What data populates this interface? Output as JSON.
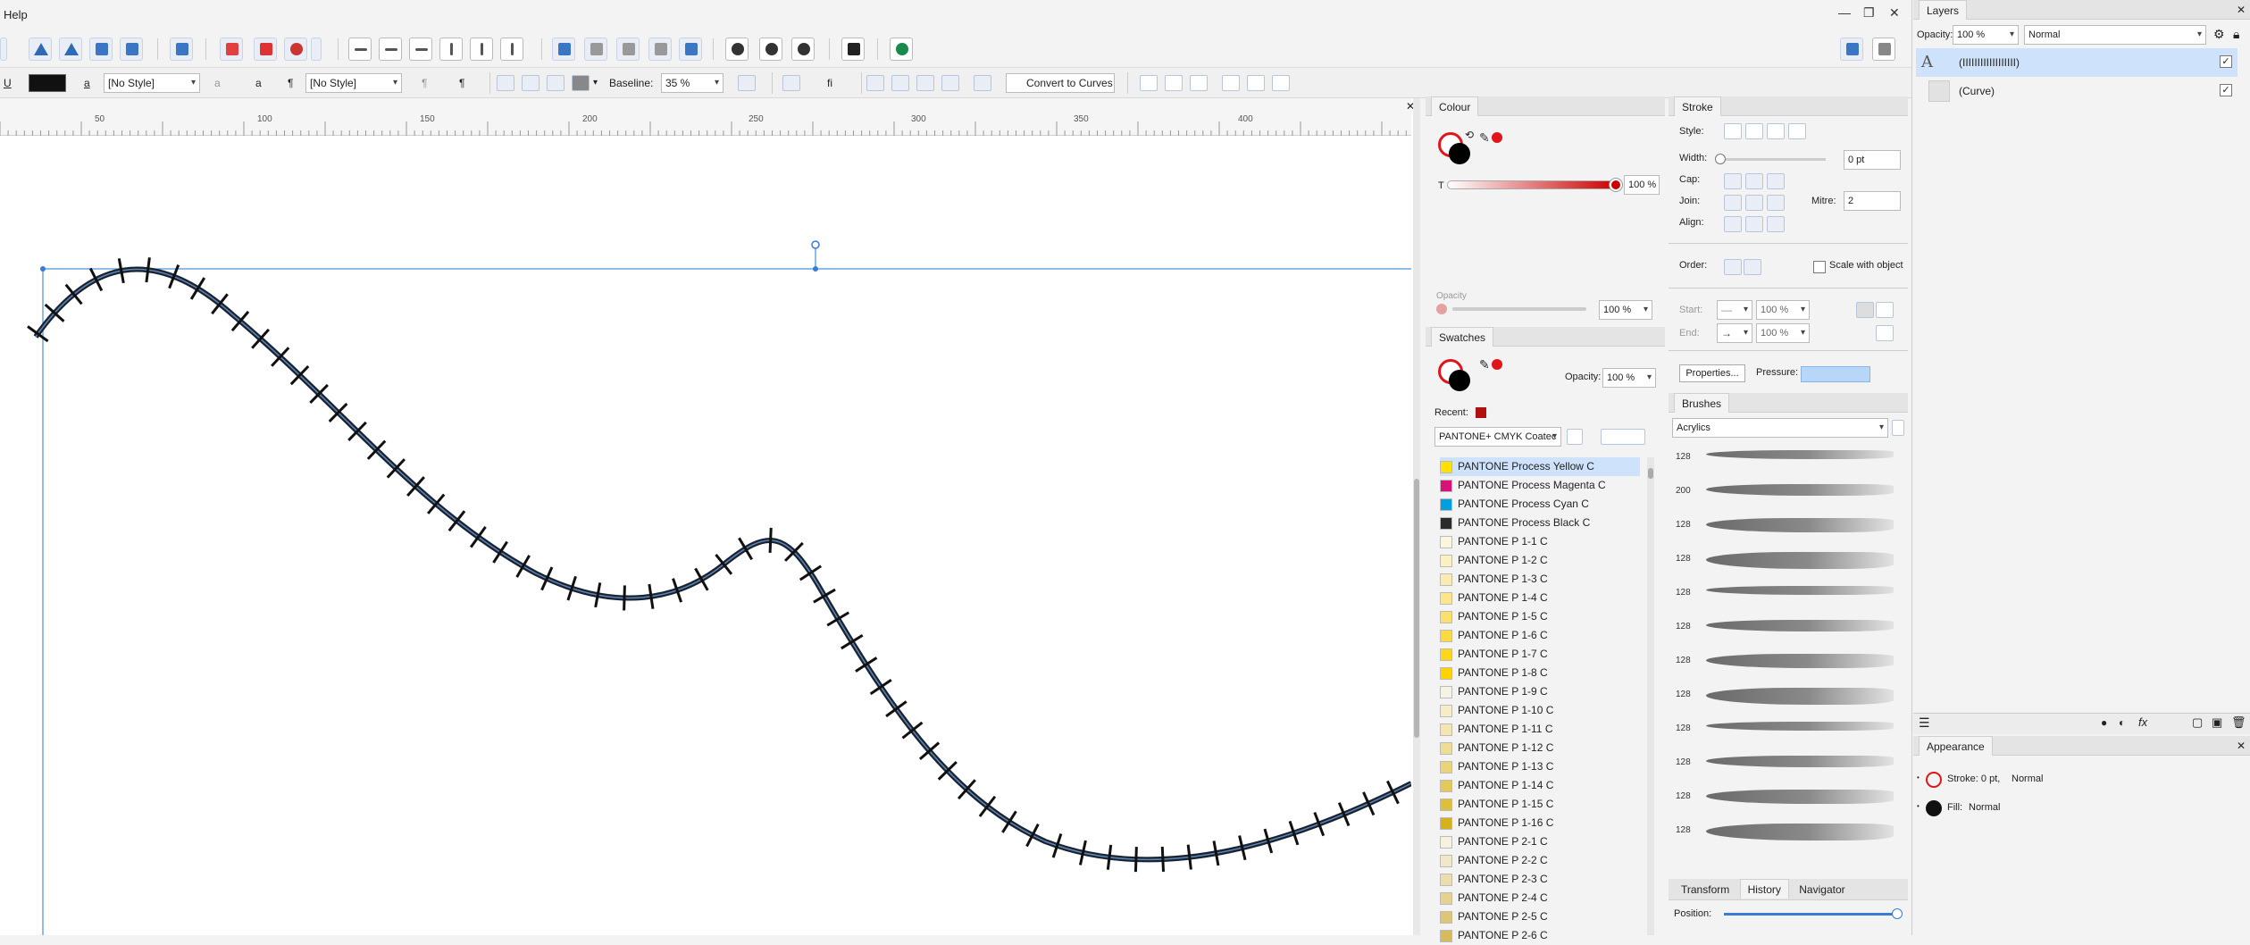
{
  "menu": {
    "help": "Help"
  },
  "window": {
    "minimize": "—",
    "restore": "❐",
    "close": "✕"
  },
  "context_toolbar": {
    "underline": "U",
    "char_style": "[No Style]",
    "para_style": "[No Style]",
    "char_icon_a": "a",
    "char_icon_a2": "a",
    "pilcrow": "¶",
    "pilcrow2": "¶",
    "baseline_label": "Baseline:",
    "baseline_value": "35 %",
    "fi": "fi",
    "convert_to_curves": "Convert to Curves"
  },
  "ruler": {
    "ticks": [
      "50",
      "100",
      "150",
      "200",
      "250",
      "300",
      "350",
      "400"
    ]
  },
  "colour_panel": {
    "title": "Colour",
    "t_label": "T",
    "t_value": "100 %",
    "opacity_label": "Opacity",
    "opacity_value": "100 %"
  },
  "swatches_panel": {
    "title": "Swatches",
    "opacity_label": "Opacity:",
    "opacity_value": "100 %",
    "recent_label": "Recent:",
    "palette": "PANTONE+ CMYK Coatec",
    "items": [
      {
        "name": "PANTONE Process Yellow C",
        "color": "#FFE000"
      },
      {
        "name": "PANTONE Process Magenta C",
        "color": "#D6127A"
      },
      {
        "name": "PANTONE Process Cyan C",
        "color": "#009FDF"
      },
      {
        "name": "PANTONE Process Black C",
        "color": "#2B2B2B"
      },
      {
        "name": "PANTONE P 1-1 C",
        "color": "#FAF6E0"
      },
      {
        "name": "PANTONE P 1-2 C",
        "color": "#FBF0C0"
      },
      {
        "name": "PANTONE P 1-3 C",
        "color": "#FBEBB0"
      },
      {
        "name": "PANTONE P 1-4 C",
        "color": "#FCE58A"
      },
      {
        "name": "PANTONE P 1-5 C",
        "color": "#FCE06A"
      },
      {
        "name": "PANTONE P 1-6 C",
        "color": "#FDDB40"
      },
      {
        "name": "PANTONE P 1-7 C",
        "color": "#FFD61A"
      },
      {
        "name": "PANTONE P 1-8 C",
        "color": "#FFD200"
      },
      {
        "name": "PANTONE P 1-9 C",
        "color": "#F7F3E4"
      },
      {
        "name": "PANTONE P 1-10 C",
        "color": "#F6EDC6"
      },
      {
        "name": "PANTONE P 1-11 C",
        "color": "#F3E6AE"
      },
      {
        "name": "PANTONE P 1-12 C",
        "color": "#EEDD92"
      },
      {
        "name": "PANTONE P 1-13 C",
        "color": "#E9D47A"
      },
      {
        "name": "PANTONE P 1-14 C",
        "color": "#E2C95A"
      },
      {
        "name": "PANTONE P 1-15 C",
        "color": "#DDBF3C"
      },
      {
        "name": "PANTONE P 1-16 C",
        "color": "#D5B21C"
      },
      {
        "name": "PANTONE P 2-1 C",
        "color": "#F6F1DE"
      },
      {
        "name": "PANTONE P 2-2 C",
        "color": "#F1E8C6"
      },
      {
        "name": "PANTONE P 2-3 C",
        "color": "#ECDDAA"
      },
      {
        "name": "PANTONE P 2-4 C",
        "color": "#E5D190"
      },
      {
        "name": "PANTONE P 2-5 C",
        "color": "#DFC677"
      },
      {
        "name": "PANTONE P 2-6 C",
        "color": "#D7BA5E"
      }
    ]
  },
  "stroke_panel": {
    "title": "Stroke",
    "style_label": "Style:",
    "width_label": "Width:",
    "width_value": "0 pt",
    "cap_label": "Cap:",
    "join_label": "Join:",
    "mitre_label": "Mitre:",
    "mitre_value": "2",
    "align_label": "Align:",
    "order_label": "Order:",
    "scale_label": "Scale with object",
    "start_label": "Start:",
    "start_value": "100 %",
    "end_label": "End:",
    "end_value": "100 %",
    "properties": "Properties...",
    "pressure_label": "Pressure:"
  },
  "brushes_panel": {
    "title": "Brushes",
    "category": "Acrylics",
    "sizes": [
      "128",
      "200",
      "128",
      "128",
      "128",
      "128",
      "128",
      "128",
      "128",
      "128",
      "128",
      "128"
    ]
  },
  "bottom_tabs": {
    "transform": "Transform",
    "history": "History",
    "navigator": "Navigator",
    "position_label": "Position:"
  },
  "layers_panel": {
    "title": "Layers",
    "opacity_label": "Opacity:",
    "opacity_value": "100 %",
    "blend": "Normal",
    "items": [
      {
        "name": "(IIIIIIIIIIIIIIIIII)",
        "icon": "A",
        "checked": "✓"
      },
      {
        "name": "(Curve)",
        "icon": "",
        "checked": "✓"
      }
    ]
  },
  "appearance_panel": {
    "title": "Appearance",
    "stroke": "Stroke: 0 pt,",
    "stroke_mode": "Normal",
    "fill": "Fill:",
    "fill_mode": "Normal"
  },
  "colors": {
    "accent": "#2f6ab5",
    "selection": "#cfe2fb",
    "curve": "#1a2230",
    "red": "#e0161b",
    "recent_swatch": "#b01010"
  }
}
